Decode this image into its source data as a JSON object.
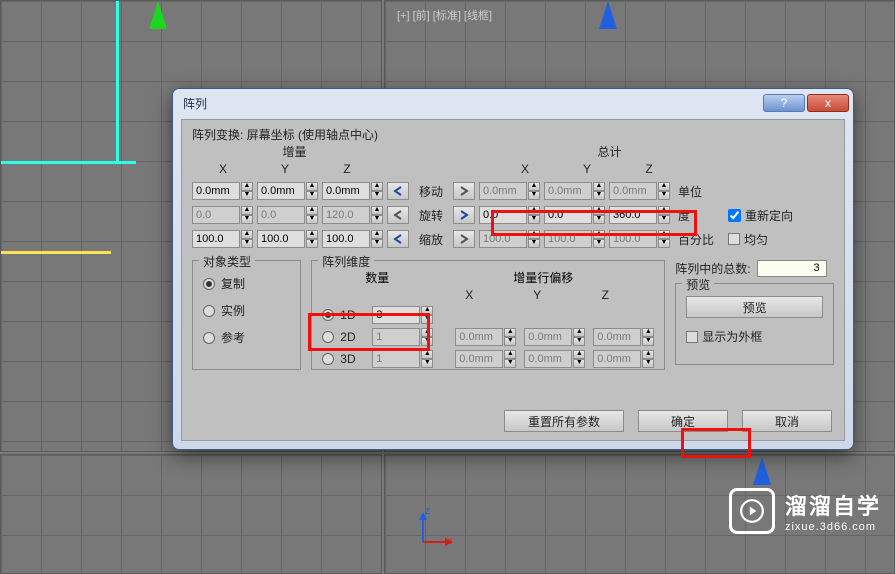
{
  "viewport": {
    "label": "[+] [前] [标准]  [线框]"
  },
  "dialog": {
    "title": "阵列",
    "transformHeader": "阵列变换: 屏幕坐标 (使用轴点中心)",
    "incLabel": "增量",
    "totalLabel": "总计",
    "axis": {
      "x": "X",
      "y": "Y",
      "z": "Z"
    },
    "rows": {
      "move": {
        "label": "移动",
        "incX": "0.0mm",
        "incY": "0.0mm",
        "incZ": "0.0mm",
        "totX": "0.0mm",
        "totY": "0.0mm",
        "totZ": "0.0mm",
        "unit": "单位"
      },
      "rotate": {
        "label": "旋转",
        "incX": "0.0",
        "incY": "0.0",
        "incZ": "120.0",
        "totX": "0.0",
        "totY": "0.0",
        "totZ": "360.0",
        "unit": "度",
        "reorient": "重新定向"
      },
      "scale": {
        "label": "缩放",
        "incX": "100.0",
        "incY": "100.0",
        "incZ": "100.0",
        "totX": "100.0",
        "totY": "100.0",
        "totZ": "100.0",
        "unit": "百分比",
        "uniform": "均匀"
      }
    },
    "objType": {
      "legend": "对象类型",
      "copy": "复制",
      "instance": "实例",
      "reference": "参考"
    },
    "dims": {
      "legend": "阵列维度",
      "count": "数量",
      "rowOffset": "增量行偏移",
      "d1": {
        "label": "1D",
        "count": "3"
      },
      "d2": {
        "label": "2D",
        "count": "1",
        "x": "0.0mm",
        "y": "0.0mm",
        "z": "0.0mm"
      },
      "d3": {
        "label": "3D",
        "count": "1",
        "x": "0.0mm",
        "y": "0.0mm",
        "z": "0.0mm"
      }
    },
    "totalInArray": {
      "label": "阵列中的总数:",
      "value": "3"
    },
    "preview": {
      "legend": "预览",
      "btn": "预览",
      "asBox": "显示为外框"
    },
    "buttons": {
      "reset": "重置所有参数",
      "ok": "确定",
      "cancel": "取消"
    }
  },
  "watermark": {
    "title": "溜溜自学",
    "sub": "zixue.3d66.com"
  },
  "gizmo": {
    "x": "x",
    "z": "z"
  }
}
